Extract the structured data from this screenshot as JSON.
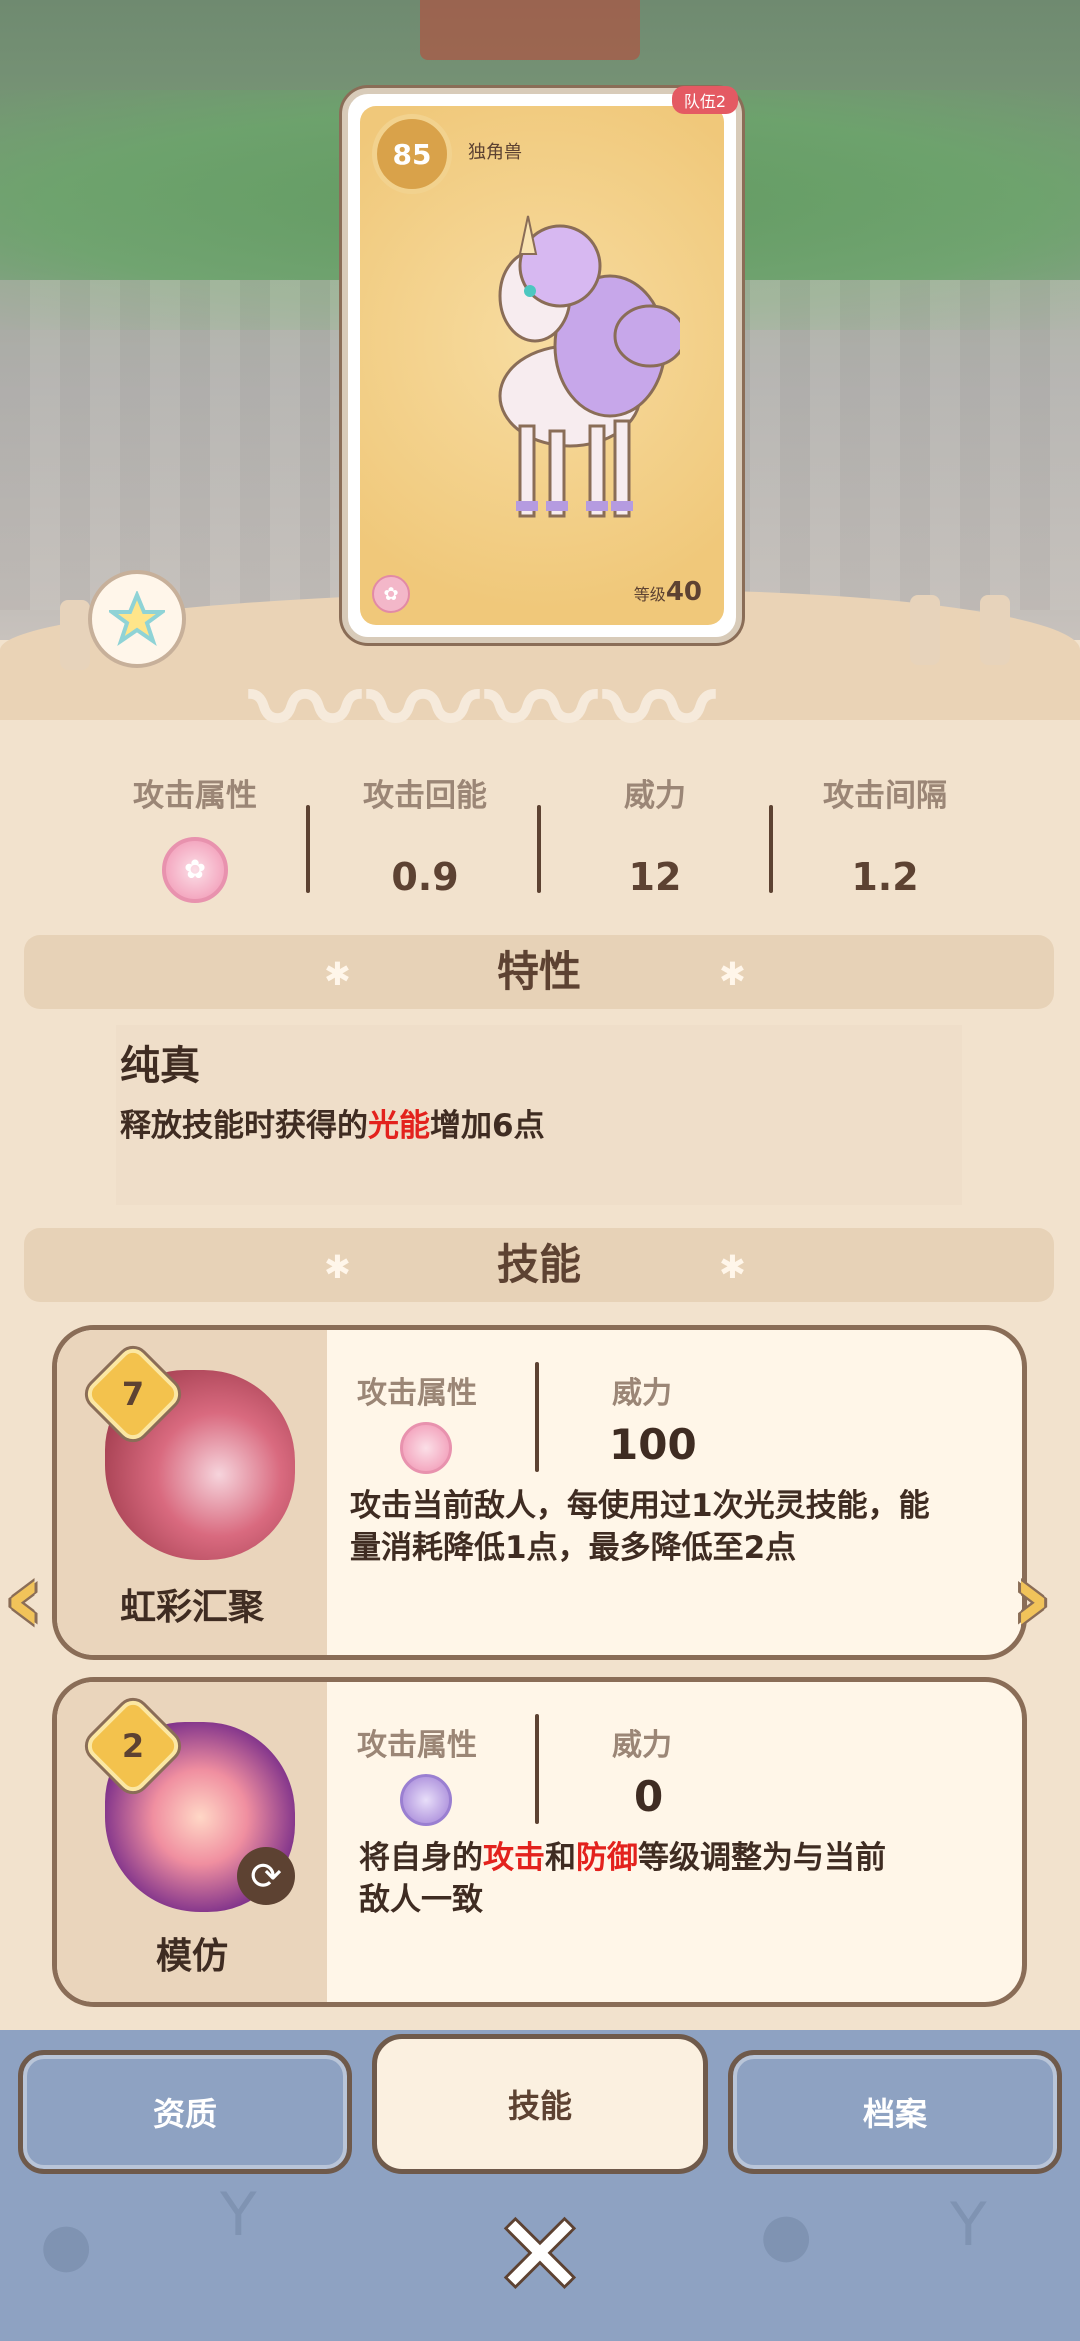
{
  "card": {
    "rank": "85",
    "name": "独角兽",
    "team_tag": "队伍2",
    "level_label": "等级",
    "level_value": "40"
  },
  "stats": [
    {
      "label": "攻击属性",
      "value": ""
    },
    {
      "label": "攻击回能",
      "value": "0.9"
    },
    {
      "label": "威力",
      "value": "12"
    },
    {
      "label": "攻击间隔",
      "value": "1.2"
    }
  ],
  "trait": {
    "header": "特性",
    "name": "纯真",
    "desc_part1": "释放技能时获得的",
    "desc_highlight": "光能",
    "desc_part2": "增加6点"
  },
  "skills_header": "技能",
  "skills": [
    {
      "cost": "7",
      "name": "虹彩汇聚",
      "attr_label": "攻击属性",
      "power_label": "威力",
      "power": "100",
      "desc_line1": "攻击当前敌人，每使用过1次光灵技能，能",
      "desc_line2": "量消耗降低1点，最多降低至2点"
    },
    {
      "cost": "2",
      "name": "模仿",
      "attr_label": "攻击属性",
      "power_label": "威力",
      "power": "0",
      "desc_p1": "将自身的",
      "desc_h1": "攻击",
      "desc_p2": "和",
      "desc_h2": "防御",
      "desc_p3": "等级调整为与当前",
      "desc_line2": "敌人一致"
    }
  ],
  "tabs": [
    "资质",
    "技能",
    "档案"
  ],
  "colors": {
    "accent_red": "#e3221d",
    "text_brown": "#5d4232",
    "tab_blue": "#8ea2c2"
  }
}
